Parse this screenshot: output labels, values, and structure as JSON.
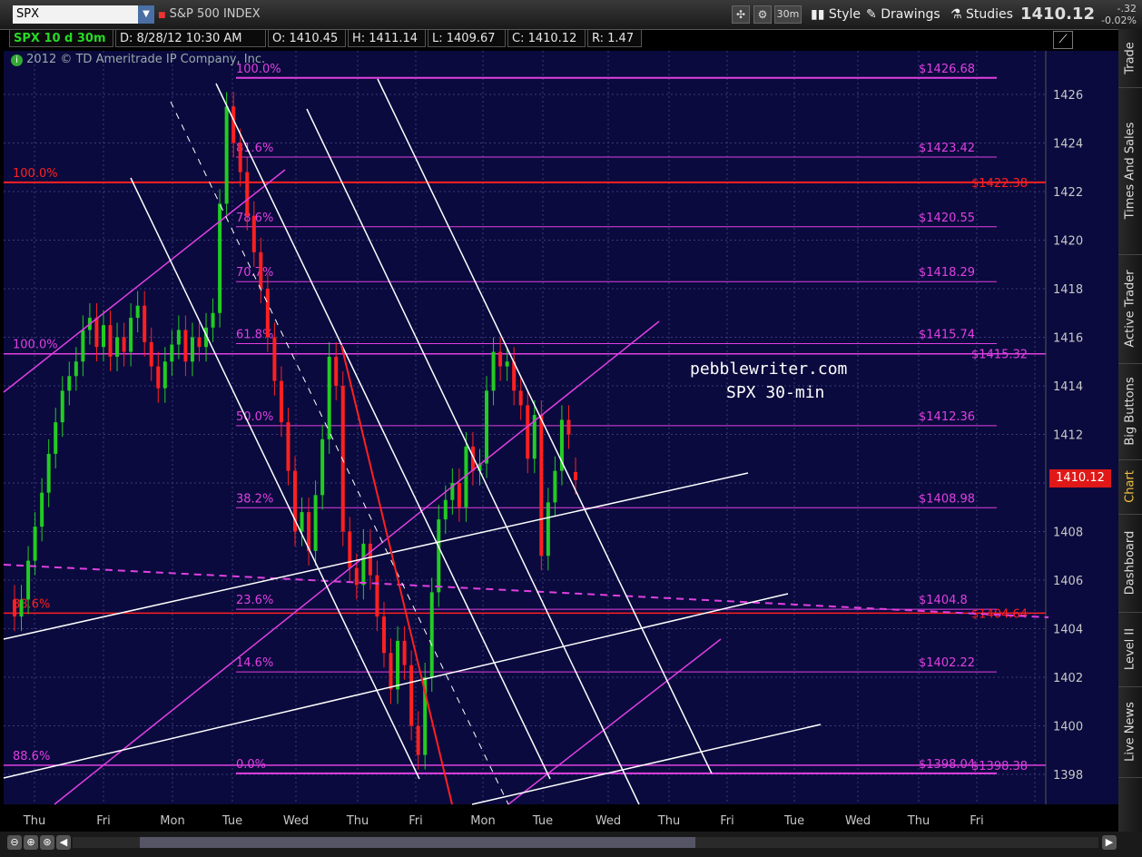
{
  "toolbar": {
    "symbol": "SPX",
    "symbol_name": "S&P 500 INDEX",
    "timeframe": "30m",
    "style_label": "Style",
    "drawings_label": "Drawings",
    "studies_label": "Studies",
    "last_price": "1410.12",
    "change": "-.32",
    "change_pct": "-0.02%"
  },
  "info_bar": {
    "chart_id": "SPX 10 d 30m",
    "date": "D: 8/28/12 10:30 AM",
    "open": "O: 1410.45",
    "high": "H: 1411.14",
    "low": "L: 1409.67",
    "close": "C: 1410.12",
    "range": "R: 1.47"
  },
  "copyright": "2012 © TD Ameritrade IP Company, Inc.",
  "watermark": {
    "line1": "pebblewriter.com",
    "line2": "SPX 30-min"
  },
  "current_price_label": "1410.12",
  "sidebar_tabs": [
    "Trade",
    "Times And Sales",
    "Active Trader",
    "Big Buttons",
    "Chart",
    "Dashboard",
    "Level II",
    "Live News"
  ],
  "colors": {
    "background": "#0a0a3e",
    "magenta": "#e040e0",
    "red": "#ff2020",
    "white": "#ffffff",
    "candle_up": "#22cc22",
    "candle_down": "#ff2020",
    "price_box": "#e01818"
  },
  "chart_data": {
    "type": "candlestick",
    "title": "",
    "ylim": [
      1397,
      1427.5
    ],
    "y_ticks": [
      1398,
      1400,
      1402,
      1404,
      1406,
      1408,
      1410,
      1412,
      1414,
      1416,
      1418,
      1420,
      1422,
      1424,
      1426
    ],
    "x_labels": [
      "Thu",
      "Fri",
      "Mon",
      "Tue",
      "Wed",
      "Thu",
      "Fri",
      "Mon",
      "Tue",
      "Wed",
      "Thu",
      "Fri",
      "Tue",
      "Wed",
      "Thu",
      "Fri"
    ],
    "grid": true,
    "fib_levels": [
      {
        "label": "100.0%",
        "price": "$1426.68",
        "value": 1426.68
      },
      {
        "label": "81.6%",
        "price": "$1423.42",
        "value": 1423.42
      },
      {
        "label": "78.6%",
        "price": "$1420.55",
        "value": 1420.55
      },
      {
        "label": "70.7%",
        "price": "$1418.29",
        "value": 1418.29
      },
      {
        "label": "61.8%",
        "price": "$1415.74",
        "value": 1415.74
      },
      {
        "label": "50.0%",
        "price": "$1412.36",
        "value": 1412.36
      },
      {
        "label": "38.2%",
        "price": "$1408.98",
        "value": 1408.98
      },
      {
        "label": "23.6%",
        "price": "$1404.8",
        "value": 1404.8
      },
      {
        "label": "14.6%",
        "price": "$1402.22",
        "value": 1402.22
      },
      {
        "label": "0.0%",
        "price": "$1398.04",
        "value": 1398.04
      }
    ],
    "horizontal_lines": [
      {
        "label": "100.0%",
        "price": "$1422.38",
        "value": 1422.38,
        "color": "red"
      },
      {
        "label": "100.0%",
        "price": "$1415.32",
        "value": 1415.32,
        "color": "magenta"
      },
      {
        "label": "88.6%",
        "price": "$1404.64",
        "value": 1404.64,
        "color": "red"
      },
      {
        "label": "88.6%",
        "price": "$1398.38",
        "value": 1398.38,
        "color": "magenta"
      }
    ],
    "closes": [
      1404.5,
      1405.2,
      1406.8,
      1408.2,
      1409.6,
      1411.2,
      1412.5,
      1413.8,
      1414.4,
      1415.0,
      1416.3,
      1416.8,
      1415.6,
      1416.5,
      1415.2,
      1416.0,
      1415.4,
      1416.8,
      1417.3,
      1415.8,
      1414.8,
      1413.9,
      1415.0,
      1415.7,
      1416.3,
      1415.0,
      1416.0,
      1415.6,
      1416.4,
      1417.0,
      1421.5,
      1425.5,
      1424.0,
      1422.8,
      1421.0,
      1419.5,
      1418.0,
      1416.0,
      1414.2,
      1412.5,
      1410.5,
      1408.0,
      1408.8,
      1407.2,
      1409.5,
      1411.8,
      1415.2,
      1414.0,
      1408.0,
      1406.5,
      1405.8,
      1407.5,
      1406.2,
      1404.5,
      1403.0,
      1401.5,
      1403.5,
      1402.5,
      1400.0,
      1398.8,
      1402.0,
      1405.5,
      1408.5,
      1409.3,
      1410.0,
      1409.0,
      1411.5,
      1410.5,
      1410.8,
      1413.8,
      1415.4,
      1414.8,
      1415.0,
      1413.8,
      1413.2,
      1411.0,
      1412.8,
      1407.0,
      1409.2,
      1410.5,
      1412.6,
      1412.0,
      1410.12
    ],
    "opens": [
      1405.2,
      1404.5,
      1405.2,
      1406.8,
      1408.2,
      1409.6,
      1411.2,
      1412.5,
      1413.8,
      1414.4,
      1415.0,
      1416.3,
      1416.8,
      1415.6,
      1416.5,
      1415.2,
      1416.0,
      1415.4,
      1416.8,
      1417.3,
      1415.8,
      1414.8,
      1413.9,
      1415.0,
      1415.7,
      1416.3,
      1415.0,
      1416.0,
      1415.6,
      1416.4,
      1417.0,
      1421.5,
      1425.5,
      1424.0,
      1422.8,
      1421.0,
      1419.5,
      1418.0,
      1416.0,
      1414.2,
      1412.5,
      1410.5,
      1408.0,
      1408.8,
      1407.2,
      1409.5,
      1411.8,
      1415.2,
      1414.0,
      1408.0,
      1406.5,
      1405.8,
      1407.5,
      1406.2,
      1404.5,
      1403.0,
      1401.5,
      1403.5,
      1402.5,
      1400.0,
      1398.8,
      1402.0,
      1405.5,
      1408.5,
      1409.3,
      1410.0,
      1409.0,
      1411.5,
      1410.5,
      1410.8,
      1413.8,
      1415.4,
      1414.8,
      1415.0,
      1413.8,
      1413.2,
      1411.0,
      1412.8,
      1407.0,
      1409.2,
      1410.5,
      1412.6,
      1410.45
    ]
  }
}
